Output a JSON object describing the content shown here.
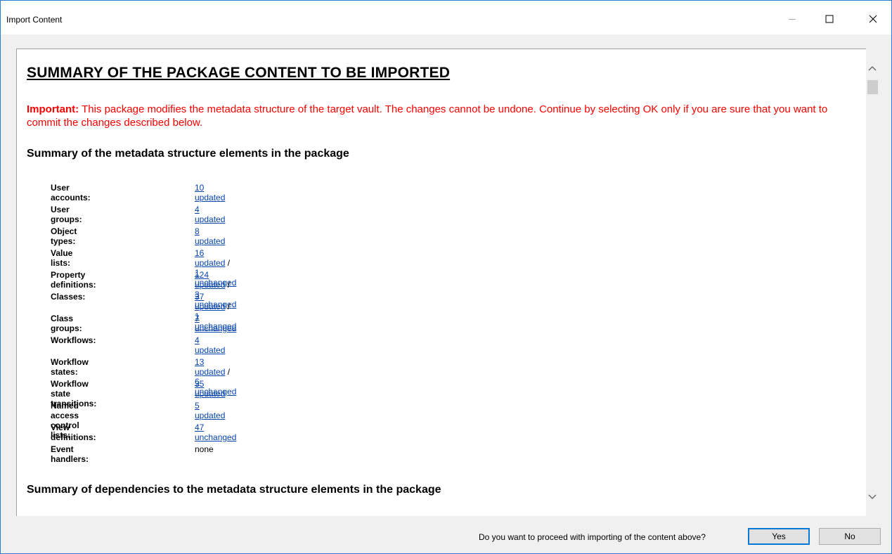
{
  "window": {
    "title": "Import Content"
  },
  "content": {
    "heading": "SUMMARY OF THE PACKAGE CONTENT TO BE IMPORTED",
    "warning_label": "Important:",
    "warning_text": " This package modifies the metadata structure of the target vault. The changes cannot be undone. Continue by selecting OK only if you are sure that you want to commit the changes described below.",
    "section1_title": "Summary of the metadata structure elements in the package",
    "section2_title": "Summary of dependencies to the metadata structure elements in the package",
    "rows": [
      {
        "label": "User accounts:",
        "link1": "10 updated",
        "sep": "",
        "link2": ""
      },
      {
        "label": "User groups:",
        "link1": "4 updated",
        "sep": "",
        "link2": ""
      },
      {
        "label": "Object types:",
        "link1": "8 updated",
        "sep": "",
        "link2": ""
      },
      {
        "label": "Value lists:",
        "link1": "16 updated",
        "sep": " / ",
        "link2": "1 unchanged"
      },
      {
        "label": "Property definitions:",
        "link1": "124 updated",
        "sep": " / ",
        "link2": "3 unchanged"
      },
      {
        "label": "Classes:",
        "link1": "37 updated",
        "sep": " / ",
        "link2": "1 unchanged"
      },
      {
        "label": "Class groups:",
        "link1": "7 unchanged",
        "sep": "",
        "link2": ""
      },
      {
        "label": "Workflows:",
        "link1": "4 updated",
        "sep": "",
        "link2": ""
      },
      {
        "label": "Workflow states:",
        "link1": "13 updated",
        "sep": " / ",
        "link2": "6 unchanged"
      },
      {
        "label": "Workflow state transitions:",
        "link1": "35 updated",
        "sep": "",
        "link2": ""
      },
      {
        "label": "Named access control lists:",
        "link1": "5 updated",
        "sep": "",
        "link2": ""
      },
      {
        "label": "View definitions:",
        "link1": "47 unchanged",
        "sep": "",
        "link2": ""
      },
      {
        "label": "Event handlers:",
        "plain": "none"
      }
    ]
  },
  "footer": {
    "question": "Do you want to proceed with importing of the content above?",
    "yes_label": "Yes",
    "no_label": "No"
  },
  "colors": {
    "warning": "#ff0000",
    "link": "#0645ad",
    "focus": "#0078d7"
  }
}
